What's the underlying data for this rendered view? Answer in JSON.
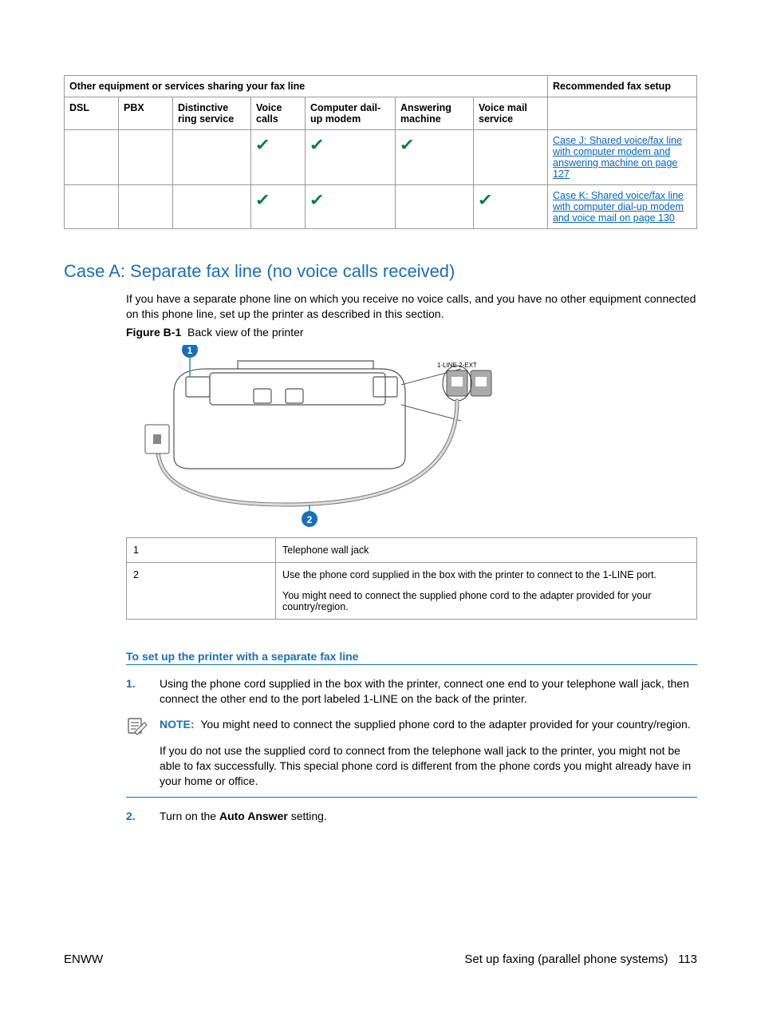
{
  "table": {
    "group_left": "Other equipment or services sharing your fax line",
    "group_right": "Recommended fax setup",
    "columns": [
      "DSL",
      "PBX",
      "Distinctive ring service",
      "Voice calls",
      "Computer dail-up modem",
      "Answering machine",
      "Voice mail service"
    ],
    "rows": [
      {
        "checks": [
          false,
          false,
          false,
          true,
          true,
          true,
          false
        ],
        "link": "Case J: Shared voice/fax line with computer modem and answering machine on page 127"
      },
      {
        "checks": [
          false,
          false,
          false,
          true,
          true,
          false,
          true
        ],
        "link": "Case K: Shared voice/fax line with computer dial-up modem and voice mail on page 130"
      }
    ]
  },
  "section_heading": "Case A: Separate fax line (no voice calls received)",
  "intro": "If you have a separate phone line on which you receive no voice calls, and you have no other equipment connected on this phone line, set up the printer as described in this section.",
  "figure": {
    "label": "Figure B-1",
    "caption": "Back view of the printer",
    "port_label": "1-LINE  2-EXT",
    "callout1": "1",
    "callout2": "2"
  },
  "callouts": [
    {
      "num": "1",
      "text": "Telephone wall jack"
    },
    {
      "num": "2",
      "text": "Use the phone cord supplied in the box with the printer to connect to the 1-LINE port.",
      "text2": "You might need to connect the supplied phone cord to the adapter provided for your country/region."
    }
  ],
  "setup_heading": "To set up the printer with a separate fax line",
  "steps": {
    "s1": "Using the phone cord supplied in the box with the printer, connect one end to your telephone wall jack, then connect the other end to the port labeled 1-LINE on the back of the printer.",
    "note_label": "NOTE:",
    "note_text": "You might need to connect the supplied phone cord to the adapter provided for your country/region.",
    "note_para": "If you do not use the supplied cord to connect from the telephone wall jack to the printer, you might not be able to fax successfully. This special phone cord is different from the phone cords you might already have in your home or office.",
    "s2_pre": "Turn on the ",
    "s2_bold": "Auto Answer",
    "s2_post": " setting."
  },
  "footer": {
    "left": "ENWW",
    "right_text": "Set up faxing (parallel phone systems)",
    "page": "113"
  }
}
